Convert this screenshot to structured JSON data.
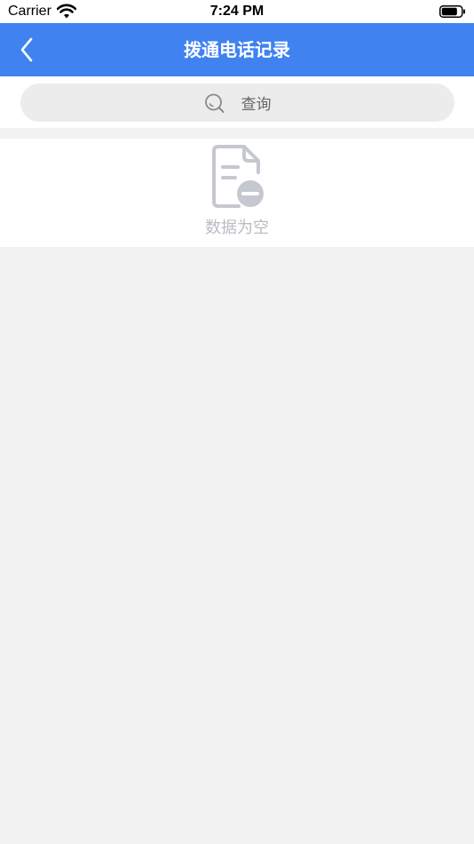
{
  "status_bar": {
    "carrier": "Carrier",
    "time": "7:24 PM",
    "wifi_icon": "wifi-icon",
    "battery_icon": "battery-icon"
  },
  "nav": {
    "title": "拨通电话记录",
    "back_icon": "chevron-left-icon",
    "background_color": "#3f82f0"
  },
  "search": {
    "placeholder": "查询",
    "icon": "search-icon"
  },
  "empty_state": {
    "text": "数据为空",
    "icon": "empty-document-icon"
  }
}
